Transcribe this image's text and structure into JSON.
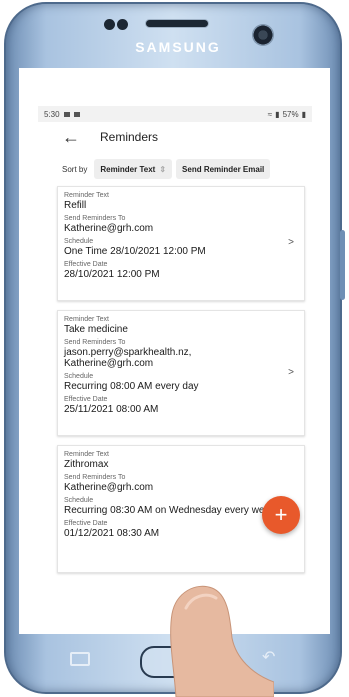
{
  "device": {
    "brand": "SAMSUNG"
  },
  "status_bar": {
    "time": "5:30",
    "battery": "57%"
  },
  "app_bar": {
    "title": "Reminders"
  },
  "sort": {
    "label": "Sort by",
    "chips": [
      "Reminder Text",
      "Send Reminder Email"
    ]
  },
  "reminders": [
    {
      "fields": [
        {
          "label": "Reminder Text",
          "value": "Refill"
        },
        {
          "label": "Send Reminders To",
          "value": "Katherine@grh.com"
        },
        {
          "label": "Schedule",
          "value": "One Time 28/10/2021 12:00 PM"
        },
        {
          "label": "Effective Date",
          "value": "28/10/2021 12:00 PM"
        }
      ]
    },
    {
      "fields": [
        {
          "label": "Reminder Text",
          "value": "Take medicine"
        },
        {
          "label": "Send Reminders To",
          "value": "jason.perry@sparkhealth.nz, Katherine@grh.com"
        },
        {
          "label": "Schedule",
          "value": "Recurring 08:00 AM every day"
        },
        {
          "label": "Effective Date",
          "value": "25/11/2021 08:00 AM"
        }
      ]
    },
    {
      "fields": [
        {
          "label": "Reminder Text",
          "value": "Zithromax"
        },
        {
          "label": "Send Reminders To",
          "value": "Katherine@grh.com"
        },
        {
          "label": "Schedule",
          "value": "Recurring 08:30 AM on Wednesday every week"
        },
        {
          "label": "Effective Date",
          "value": "01/12/2021 08:30 AM"
        }
      ]
    }
  ],
  "fab": {
    "icon": "plus-icon",
    "symbol": "+",
    "color": "#e8592b"
  },
  "colors": {
    "phone_body": "#a9c3e0",
    "accent": "#e8592b"
  }
}
